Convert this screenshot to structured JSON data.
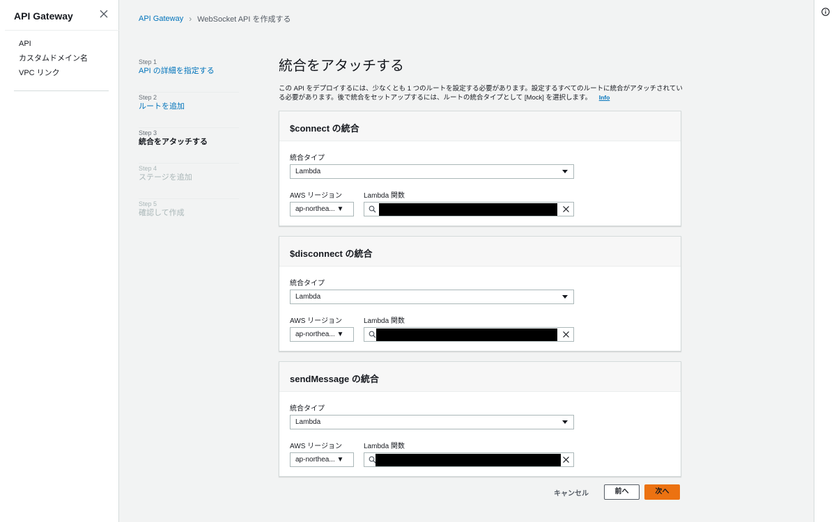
{
  "nav": {
    "title": "API Gateway",
    "items": [
      {
        "label": "API"
      },
      {
        "label": "カスタムドメイン名"
      },
      {
        "label": "VPC リンク"
      }
    ]
  },
  "breadcrumb": {
    "root": "API Gateway",
    "current": "WebSocket API を作成する"
  },
  "steps": [
    {
      "num": "Step 1",
      "title": "API の詳細を指定する",
      "state": "link"
    },
    {
      "num": "Step 2",
      "title": "ルートを追加",
      "state": "link"
    },
    {
      "num": "Step 3",
      "title": "統合をアタッチする",
      "state": "active"
    },
    {
      "num": "Step 4",
      "title": "ステージを追加",
      "state": "disabled"
    },
    {
      "num": "Step 5",
      "title": "確認して作成",
      "state": "disabled"
    }
  ],
  "page": {
    "title": "統合をアタッチする",
    "description": "この API をデプロイするには、少なくとも 1 つのルートを設定する必要があります。設定するすべてのルートに統合がアタッチされている必要があります。後で統合をセットアップするには、ルートの統合タイプとして [Mock] を選択します。",
    "info_link": "Info"
  },
  "labels": {
    "integration_type": "統合タイプ",
    "region": "AWS リージョン",
    "lambda_function": "Lambda 関数"
  },
  "panels": [
    {
      "title": "$connect の統合",
      "integration_type": "Lambda",
      "region": "ap-northea... ▼"
    },
    {
      "title": "$disconnect の統合",
      "integration_type": "Lambda",
      "region": "ap-northea... ▼"
    },
    {
      "title": "sendMessage の統合",
      "integration_type": "Lambda",
      "region": "ap-northea... ▼"
    }
  ],
  "actions": {
    "cancel": "キャンセル",
    "prev": "前へ",
    "next": "次へ"
  },
  "colors": {
    "link": "#0073bb",
    "primary_button": "#ec7211",
    "redaction": "#000000"
  }
}
